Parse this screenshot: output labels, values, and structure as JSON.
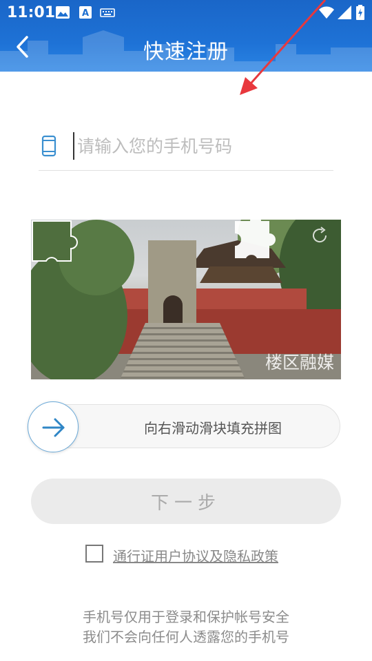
{
  "status_bar": {
    "time": "11:01",
    "left_icons": [
      "image-icon",
      "text-a-icon",
      "keyboard-icon"
    ],
    "right_icons": [
      "wifi-icon",
      "signal-icon",
      "battery-icon"
    ]
  },
  "header": {
    "title": "快速注册",
    "back_icon": "chevron-left-icon",
    "background_color": "#1e72d6"
  },
  "phone_field": {
    "placeholder": "请输入您的手机号码",
    "value": "",
    "icon": "mobile-phone-icon",
    "icon_color": "#3a8fd0"
  },
  "captcha": {
    "watermark": "楼区融媒",
    "refresh_icon": "refresh-icon"
  },
  "slider": {
    "hint": "向右滑动滑块填充拼图",
    "knob_icon": "arrow-right-icon",
    "accent_color": "#2f86c6"
  },
  "next_button": {
    "label": "下一步"
  },
  "agreement": {
    "checked": false,
    "link_text": "通行证用户协议及隐私政策"
  },
  "footer": {
    "line1": "手机号仅用于登录和保护帐号安全",
    "line2": "我们不会向任何人透露您的手机号"
  },
  "annotation": {
    "color": "#e8383d"
  }
}
